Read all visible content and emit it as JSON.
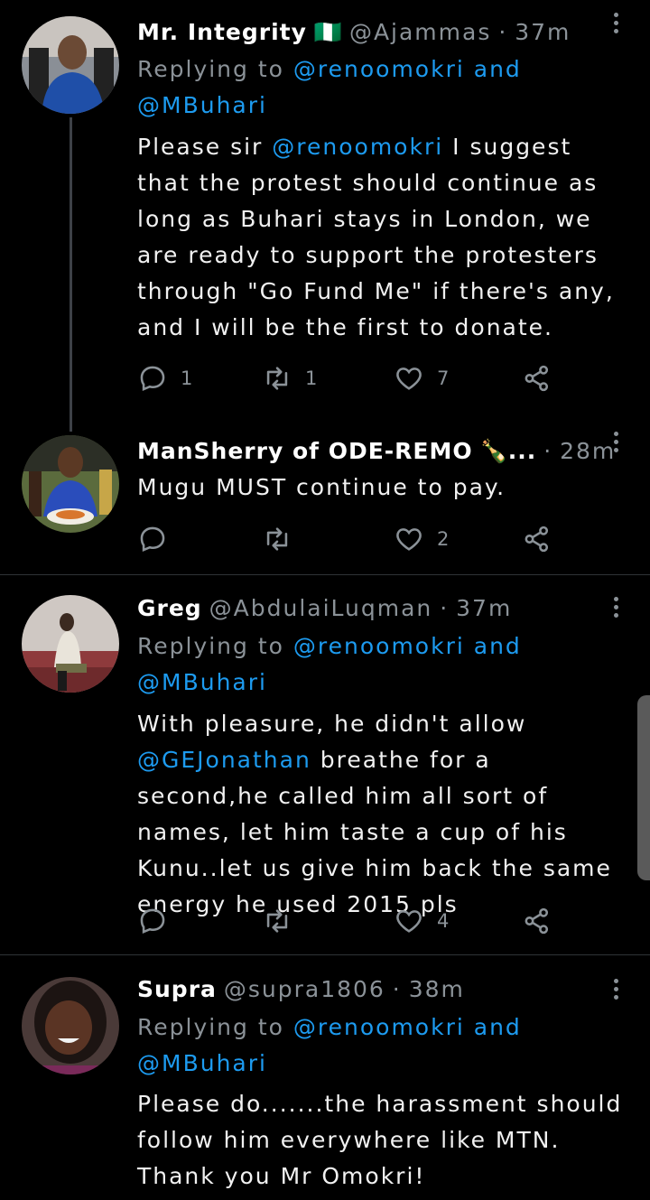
{
  "tweets": [
    {
      "name": "Mr. Integrity",
      "flag": "🇳🇬",
      "handle": "@Ajammas",
      "time": "37m",
      "replying_prefix": "Replying to",
      "replying_user1": "@renoomokri",
      "replying_and": "and",
      "replying_user2": "@MBuhari",
      "body_pre": "Please sir ",
      "body_mention": "@renoomokri",
      "body_post": " I suggest that the protest should continue as long as Buhari stays in London, we are ready to support the protesters through \"Go Fund Me\" if there's any, and I will be the first to donate.",
      "replies": "1",
      "retweets": "1",
      "likes": "7"
    },
    {
      "name": "ManSherry of ODE-REMO",
      "emoji": "🍾",
      "ellipsis": "...",
      "time": "28m",
      "body": "Mugu MUST continue to pay.",
      "replies": "",
      "retweets": "",
      "likes": "2"
    },
    {
      "name": "Greg",
      "handle": "@AbdulaiLuqman",
      "time": "37m",
      "replying_prefix": "Replying to",
      "replying_user1": "@renoomokri",
      "replying_and": "and",
      "replying_user2": "@MBuhari",
      "body_pre": "With pleasure, he didn't allow ",
      "body_mention": "@GEJonathan",
      "body_post": " breathe for a second,he called him all sort of names, let him taste a cup of his Kunu..let us give him back the same energy he used 2015 pls",
      "replies": "",
      "retweets": "",
      "likes": "4"
    },
    {
      "name": "Supra",
      "handle": "@supra1806",
      "time": "38m",
      "replying_prefix": "Replying to",
      "replying_user1": "@renoomokri",
      "replying_and": "and",
      "replying_user2": "@MBuhari",
      "body": "Please do.......the harassment should follow him everywhere like MTN. Thank you Mr Omokri!"
    }
  ],
  "icons": [
    "reply-icon",
    "retweet-icon",
    "like-icon",
    "share-icon",
    "more-icon"
  ],
  "colors": {
    "background": "#000000",
    "mention": "#1d9bf0",
    "muted": "#8b9298",
    "divider": "#2f3336"
  }
}
